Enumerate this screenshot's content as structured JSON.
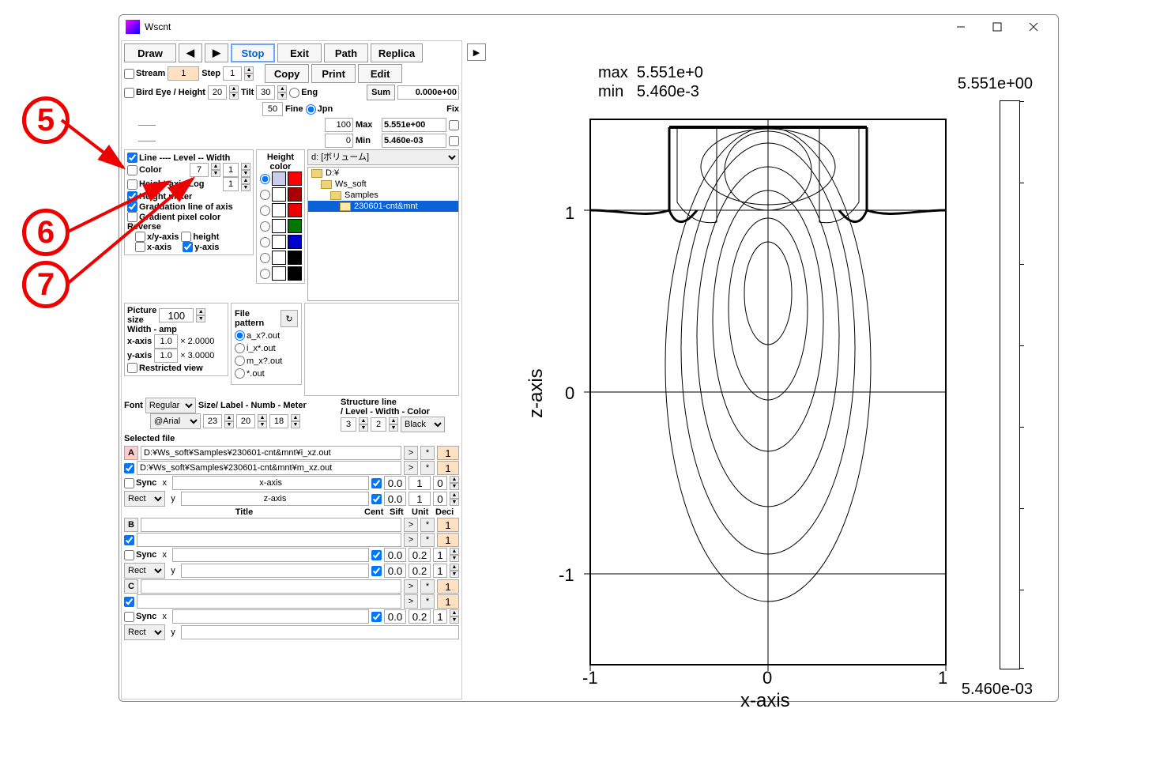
{
  "window": {
    "title": "Wscnt"
  },
  "callouts": {
    "c5": "5",
    "c6": "6",
    "c7": "7"
  },
  "toolbar": {
    "draw": "Draw",
    "stop": "Stop",
    "exit": "Exit",
    "path": "Path",
    "replica": "Replica",
    "copy": "Copy",
    "print": "Print",
    "edit": "Edit"
  },
  "stream": {
    "label": "Stream",
    "value": "1",
    "step_label": "Step",
    "step": "1"
  },
  "birdeye": {
    "label": "Bird Eye",
    "height_label": "/ Height",
    "height": "20",
    "tilt_label": "Tilt",
    "tilt": "30",
    "fifty": "50",
    "fine_label": "Fine"
  },
  "lang": {
    "eng": "Eng",
    "jpn": "Jpn"
  },
  "sum": {
    "label": "Sum",
    "value": "0.000e+00"
  },
  "range": {
    "n100": "100",
    "zero": "0",
    "max_label": "Max",
    "max": "5.551e+00",
    "min_label": "Min",
    "min": "5.460e-03",
    "fix": "Fix"
  },
  "opts": {
    "line": "Line ---- Level -- Width",
    "color": "Color",
    "color_n": "7",
    "color_w": "1",
    "hlog": "Height-axis Log",
    "hlog_n": "1",
    "hmeter": "Height meter",
    "grad": "Graduation line of axis",
    "gpix": "Gradient pixel color",
    "reverse": "Reverse",
    "xy": "x/y-axis",
    "height": "height",
    "x": "x-axis",
    "y": "y-axis"
  },
  "heightcolor": {
    "label": "Height\ncolor"
  },
  "volume": {
    "label": "d: [ボリューム]"
  },
  "tree": {
    "d": "D:¥",
    "ws": "Ws_soft",
    "samples": "Samples",
    "sel": "230601-cnt&mnt"
  },
  "pic": {
    "label": "Picture\nsize",
    "size": "100",
    "widthamp": "Width - amp",
    "xaxis": "x-axis",
    "xv": "1.0",
    "xmul": "× 2.0000",
    "yaxis": "y-axis",
    "yv": "1.0",
    "ymul": "× 3.0000",
    "restricted": "Restricted view"
  },
  "filepat": {
    "label": "File\npattern",
    "a": "a_x?.out",
    "i": "i_x*.out",
    "m": "m_x?.out",
    "o": "*.out"
  },
  "font": {
    "label": "Font",
    "style": "Regular",
    "family": "@Arial",
    "sln": "Size/ Label - Numb - Meter",
    "s1": "23",
    "s2": "20",
    "s3": "18"
  },
  "struct": {
    "label": "Structure line\n/ Level - Width - Color",
    "l": "3",
    "w": "2",
    "color": "Black"
  },
  "selfile": {
    "label": "Selected file",
    "A": "A",
    "B": "B",
    "C": "C",
    "p1": "D:¥Ws_soft¥Samples¥230601-cnt&mnt¥i_xz.out",
    "p2": "D:¥Ws_soft¥Samples¥230601-cnt&mnt¥m_xz.out",
    "sync": "Sync",
    "rect": "Rect",
    "x": "x",
    "y": "y",
    "xaxis": "x-axis",
    "zaxis": "z-axis",
    "hdr_title": "Title",
    "hdr_cent": "Cent",
    "hdr_sift": "Sift",
    "hdr_unit": "Unit",
    "hdr_deci": "Deci",
    "zz": "0.0",
    "one": "1",
    "zero": "0",
    "p02": "0.2"
  },
  "plot": {
    "maxlbl": "max",
    "maxv": "5.551e+0",
    "minlbl": "min",
    "minv": "5.460e-3",
    "bar_top": "5.551e+00",
    "bar_bot": "5.460e-03",
    "xlabel": "x-axis",
    "zlabel": "z-axis",
    "t1": "1",
    "t0": "0",
    "tm1": "-1"
  }
}
